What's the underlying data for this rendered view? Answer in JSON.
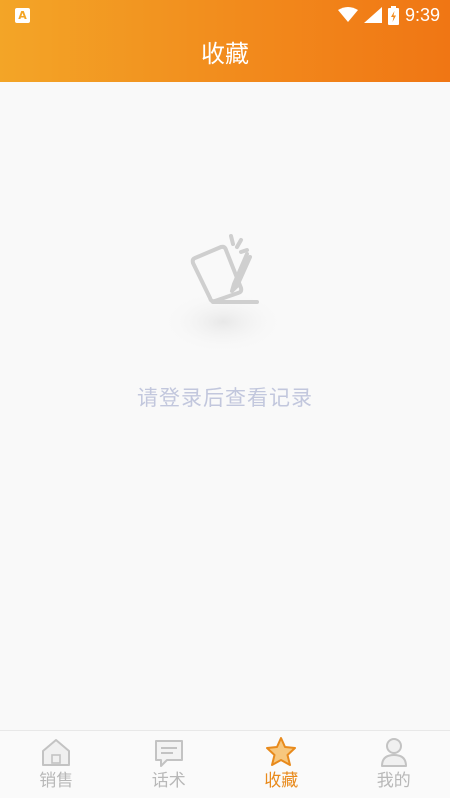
{
  "status_bar": {
    "app_icon_letter": "A",
    "time": "9:39"
  },
  "header": {
    "title": "收藏"
  },
  "empty_state": {
    "message": "请登录后查看记录"
  },
  "tab_bar": {
    "active_index": 2,
    "active_color": "#e88a1c",
    "inactive_color": "#b8b8b8",
    "tabs": [
      {
        "label": "销售",
        "icon": "home-icon"
      },
      {
        "label": "话术",
        "icon": "chat-icon"
      },
      {
        "label": "收藏",
        "icon": "star-icon"
      },
      {
        "label": "我的",
        "icon": "user-icon"
      }
    ]
  }
}
